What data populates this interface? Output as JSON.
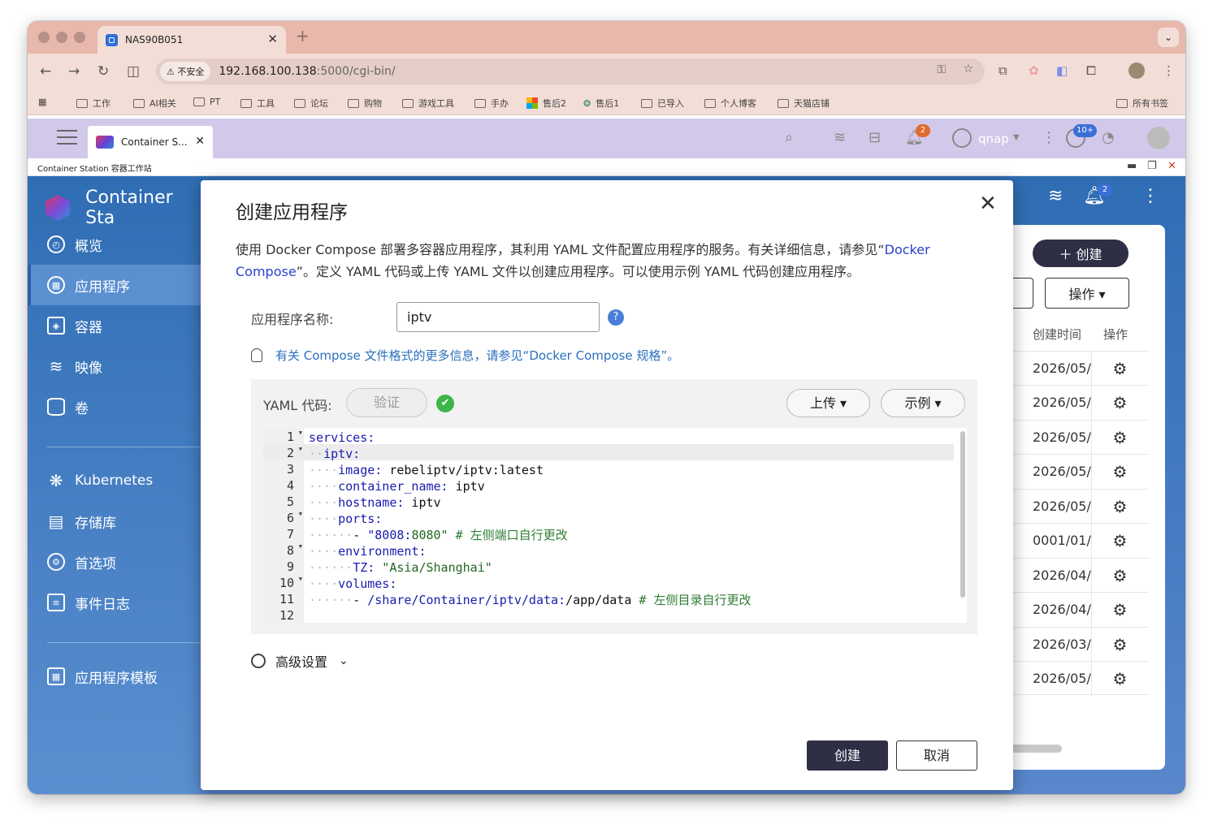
{
  "browser": {
    "tab_title": "NAS90B051",
    "new_tab": "+",
    "security_label": "不安全",
    "url_host": "192.168.100.138",
    "url_path": ":5000/cgi-bin/",
    "bookmarks": [
      "工作",
      "AI相关",
      "PT",
      "工具",
      "论坛",
      "购物",
      "游戏工具",
      "手办",
      "售后2",
      "售后1",
      "已导入",
      "个人博客",
      "天猫店铺"
    ],
    "all_bookmarks": "所有书签"
  },
  "qts": {
    "app_tab": "Container S...",
    "notification_count": "2",
    "user": "qnap",
    "update_count": "10+",
    "window_title": "Container Station 容器工作站"
  },
  "sidebar": {
    "brand": "Container Sta",
    "items": [
      {
        "label": "概览",
        "icon": "dashboard-icon"
      },
      {
        "label": "应用程序",
        "icon": "apps-icon"
      },
      {
        "label": "容器",
        "icon": "cube-icon"
      },
      {
        "label": "映像",
        "icon": "layers-icon"
      },
      {
        "label": "卷",
        "icon": "database-icon"
      },
      {
        "label": "Kubernetes",
        "icon": "kubernetes-icon"
      },
      {
        "label": "存储库",
        "icon": "registry-icon"
      },
      {
        "label": "首选项",
        "icon": "gear-icon"
      },
      {
        "label": "事件日志",
        "icon": "log-icon"
      },
      {
        "label": "应用程序模板",
        "icon": "template-icon"
      }
    ]
  },
  "background": {
    "bell_count": "2",
    "create_button": "＋ 创建",
    "ops_button": "操作 ▾",
    "col_created": "创建时间",
    "col_ops": "操作",
    "dates": [
      "2026/05/",
      "2026/05/",
      "2026/05/",
      "2026/05/",
      "2026/05/",
      "0001/01/",
      "2026/04/",
      "2026/04/",
      "2026/03/",
      "2026/05/"
    ]
  },
  "dialog": {
    "title": "创建应用程序",
    "desc_part1": "使用 Docker Compose 部署多容器应用程序，其利用 YAML 文件配置应用程序的服务。有关详细信息，请参见“",
    "desc_link": "Docker Compose",
    "desc_part2": "”。定义 YAML 代码或上传 YAML 文件以创建应用程序。可以使用示例 YAML 代码创建应用程序。",
    "name_label": "应用程序名称:",
    "name_value": "iptv",
    "help": "?",
    "tip": "有关 Compose 文件格式的更多信息，请参见“Docker Compose 规格”。",
    "yaml_label": "YAML 代码:",
    "validate_button": "验证",
    "upload_button": "上传 ▾",
    "example_button": "示例 ▾",
    "advanced": "高级设置",
    "create_button": "创建",
    "cancel_button": "取消"
  },
  "yaml_lines": [
    {
      "n": "1",
      "fold": true
    },
    {
      "n": "2",
      "fold": true
    },
    {
      "n": "3",
      "fold": false
    },
    {
      "n": "4",
      "fold": false
    },
    {
      "n": "5",
      "fold": false
    },
    {
      "n": "6",
      "fold": true
    },
    {
      "n": "7",
      "fold": false
    },
    {
      "n": "8",
      "fold": true
    },
    {
      "n": "9",
      "fold": false
    },
    {
      "n": "10",
      "fold": true
    },
    {
      "n": "11",
      "fold": false
    },
    {
      "n": "12",
      "fold": false
    }
  ],
  "yaml_code": [
    "services:",
    "  iptv:",
    "    image: rebeliptv/iptv:latest",
    "    container_name: iptv",
    "    hostname: iptv",
    "    ports:",
    "      - \"8008:8080\" # 左侧端口自行更改",
    "    environment:",
    "      TZ: \"Asia/Shanghai\"",
    "    volumes:",
    "      - /share/Container/iptv/data:/app/data # 左侧目录自行更改",
    ""
  ],
  "colors": {
    "sidebar": "#2f6db4",
    "accent_button": "#2e2e45",
    "link": "#2a3fd0",
    "ok": "#3db54a"
  }
}
